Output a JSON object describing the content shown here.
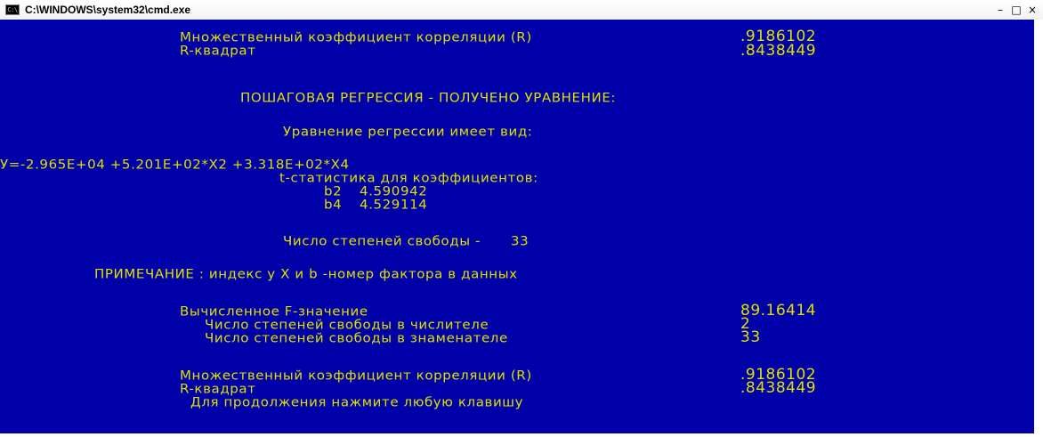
{
  "window": {
    "title": "C:\\WINDOWS\\system32\\cmd.exe",
    "icon_text": "C:\\",
    "controls": {
      "minimize": "–",
      "maximize": "□",
      "close": "×"
    }
  },
  "colors": {
    "console_background": "#0000a8",
    "console_text": "#e0e000"
  },
  "console": {
    "top_stats": {
      "r_label": "Множественный коэффициент корреляции (R)",
      "r_value": ".9186102",
      "r2_label": "R-квадрат",
      "r2_value": ".8438449"
    },
    "header": "ПОШАГОВАЯ РЕГРЕССИЯ - ПОЛУЧЕНО УРАВНЕНИЕ:",
    "equation_title": "Уравнение регрессии имеет вид:",
    "equation": "У=-2.965E+04 +5.201E+02*X2 +3.318E+02*X4",
    "t_stats_title": "t-статистика для коэффициентов:",
    "t_stats": [
      {
        "name": "b2",
        "value": "4.590942"
      },
      {
        "name": "b4",
        "value": "4.529114"
      }
    ],
    "dof_label": "Число степеней свободы -",
    "dof_value": "33",
    "note": "ПРИМЕЧАНИЕ : индекс у X и b -номер фактора в данных",
    "f_stats": {
      "f_label": "Вычисленное F-значение",
      "f_value": "89.16414",
      "num_label": "Число степеней свободы в числителе",
      "num_value": "2",
      "den_label": "Число степеней свободы в знаменателе",
      "den_value": "33"
    },
    "bottom_stats": {
      "r_label": "Множественный коэффициент корреляции (R)",
      "r_value": ".9186102",
      "r2_label": "R-квадрат",
      "r2_value": ".8438449"
    },
    "prompt": "Для продолжения нажмите любую клавишу"
  }
}
